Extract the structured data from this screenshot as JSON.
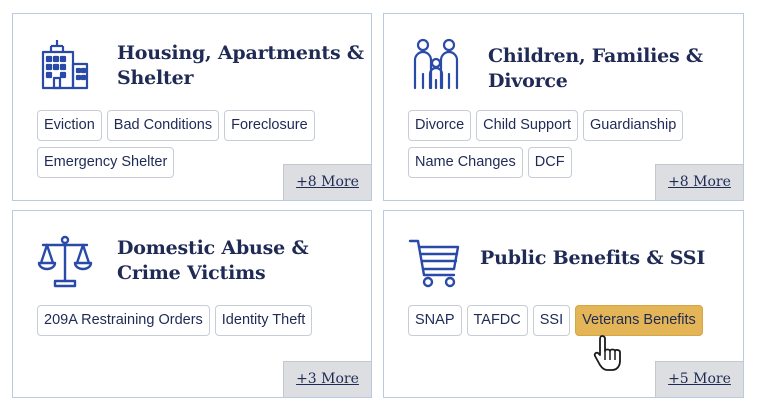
{
  "colors": {
    "card_border": "#b9cbe0",
    "title_text": "#1f2a55",
    "icon_blue": "#2a4aa8",
    "tag_active_bg": "#e3b556",
    "more_button_bg": "#dcdee2"
  },
  "cards": [
    {
      "title": "Housing, Apartments & Shelter",
      "icon": "apartment-building-icon",
      "tags": [
        "Eviction",
        "Bad Conditions",
        "Foreclosure",
        "Emergency Shelter"
      ],
      "more_label": "+8 More"
    },
    {
      "title": "Children, Families & Divorce",
      "icon": "family-icon",
      "tags": [
        "Divorce",
        "Child Support",
        "Guardianship",
        "Name Changes",
        "DCF"
      ],
      "more_label": "+8 More"
    },
    {
      "title": "Domestic Abuse & Crime Victims",
      "icon": "scales-of-justice-icon",
      "tags": [
        "209A Restraining Orders",
        "Identity Theft"
      ],
      "more_label": "+3 More"
    },
    {
      "title": "Public Benefits & SSI",
      "icon": "shopping-cart-icon",
      "tags": [
        "SNAP",
        "TAFDC",
        "SSI",
        "Veterans Benefits"
      ],
      "active_tag": "Veterans Benefits",
      "more_label": "+5 More"
    }
  ],
  "cursor": "hand-pointer-cursor-icon"
}
